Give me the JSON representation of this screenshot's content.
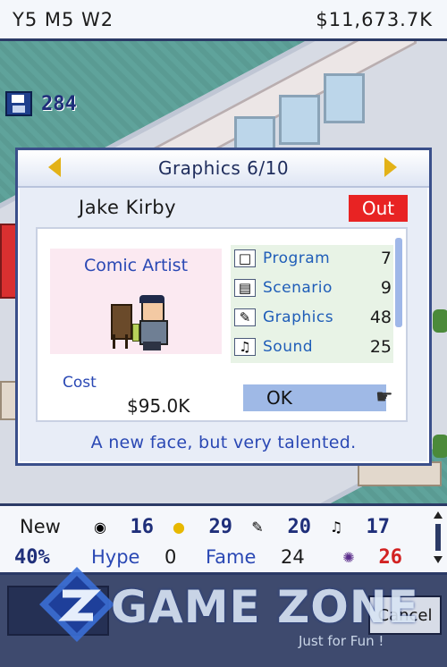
{
  "topbar": {
    "date": "Y5 M5 W2",
    "money": "$11,673.7K"
  },
  "save": {
    "count": "284",
    "icon": "floppy-disk-icon"
  },
  "dialog": {
    "title": "Graphics 6/10",
    "staff_name": "Jake Kirby",
    "status_badge": "Out",
    "job": "Comic Artist",
    "stats": [
      {
        "label": "Program",
        "value": "7",
        "icon": "computer-icon"
      },
      {
        "label": "Scenario",
        "value": "9",
        "icon": "book-icon"
      },
      {
        "label": "Graphics",
        "value": "48",
        "icon": "paint-hand-icon"
      },
      {
        "label": "Sound",
        "value": "25",
        "icon": "keyboard-icon"
      }
    ],
    "cost_label": "Cost",
    "cost_value": "$95.0K",
    "ok_label": "OK",
    "caption": "A new face, but very talented."
  },
  "status_panel": {
    "genre_label": "New",
    "fans": "16",
    "coins": "29",
    "paint": "20",
    "sound": "17",
    "percent": "40%",
    "hype_label": "Hype",
    "hype_value": "0",
    "fame_label": "Fame",
    "fame_value": "24",
    "bugs": "26"
  },
  "bottom": {
    "cancel_label": "Cancel"
  },
  "watermark": {
    "brand": "GAME ZONE",
    "tagline": "Just for Fun !"
  },
  "colors": {
    "accent_blue": "#2a48b4",
    "badge_red": "#e82323",
    "frame": "#3a4f8a",
    "arrow_yellow": "#e3b218"
  }
}
